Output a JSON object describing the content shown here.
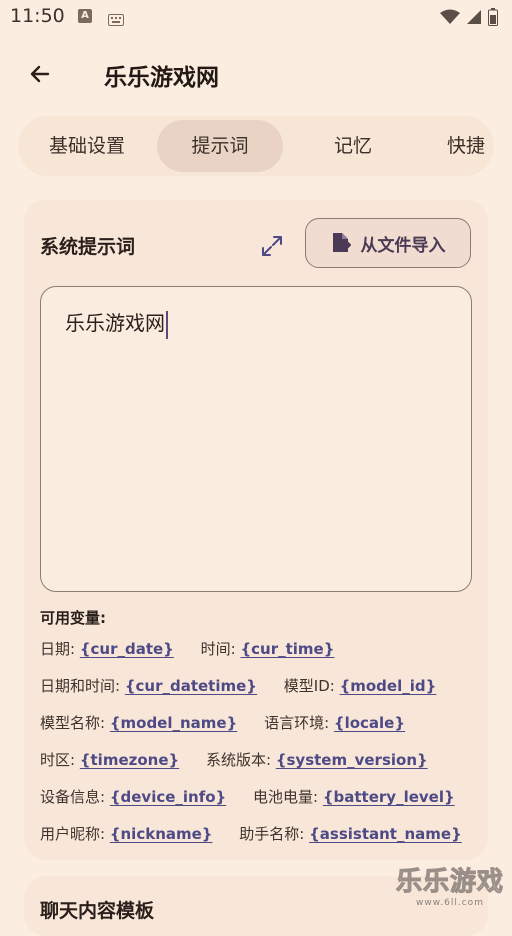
{
  "status_bar": {
    "time": "11:50",
    "notif_letter": "A"
  },
  "header": {
    "title": "乐乐游戏网"
  },
  "tabs": [
    {
      "label": "基础设置",
      "active": false
    },
    {
      "label": "提示词",
      "active": true
    },
    {
      "label": "记忆",
      "active": false
    },
    {
      "label": "快捷",
      "active": false
    }
  ],
  "system_prompt": {
    "title": "系统提示词",
    "import_label": "从文件导入",
    "value": "乐乐游戏网"
  },
  "variables": {
    "title": "可用变量:",
    "rows": [
      [
        {
          "label": "日期: ",
          "token": "{cur_date}"
        },
        {
          "label": "时间: ",
          "token": "{cur_time}"
        }
      ],
      [
        {
          "label": "日期和时间: ",
          "token": "{cur_datetime}"
        },
        {
          "label": "模型ID: ",
          "token": "{model_id}"
        }
      ],
      [
        {
          "label": "模型名称: ",
          "token": "{model_name}"
        },
        {
          "label": "语言环境: ",
          "token": "{locale}"
        }
      ],
      [
        {
          "label": "时区: ",
          "token": "{timezone}"
        },
        {
          "label": "系统版本: ",
          "token": "{system_version}"
        }
      ],
      [
        {
          "label": "设备信息: ",
          "token": "{device_info}"
        },
        {
          "label": "电池电量: ",
          "token": "{battery_level}"
        }
      ],
      [
        {
          "label": "用户昵称: ",
          "token": "{nickname}"
        },
        {
          "label": "助手名称: ",
          "token": "{assistant_name}"
        }
      ]
    ]
  },
  "next_section": {
    "title": "聊天内容模板"
  },
  "watermark": {
    "main": "乐乐游戏",
    "url": "www.6ll.com"
  },
  "colors": {
    "background": "#fbeee0",
    "card": "#f8e7d9",
    "accent": "#4e4a86",
    "tab_active": "#e9d3c5"
  }
}
